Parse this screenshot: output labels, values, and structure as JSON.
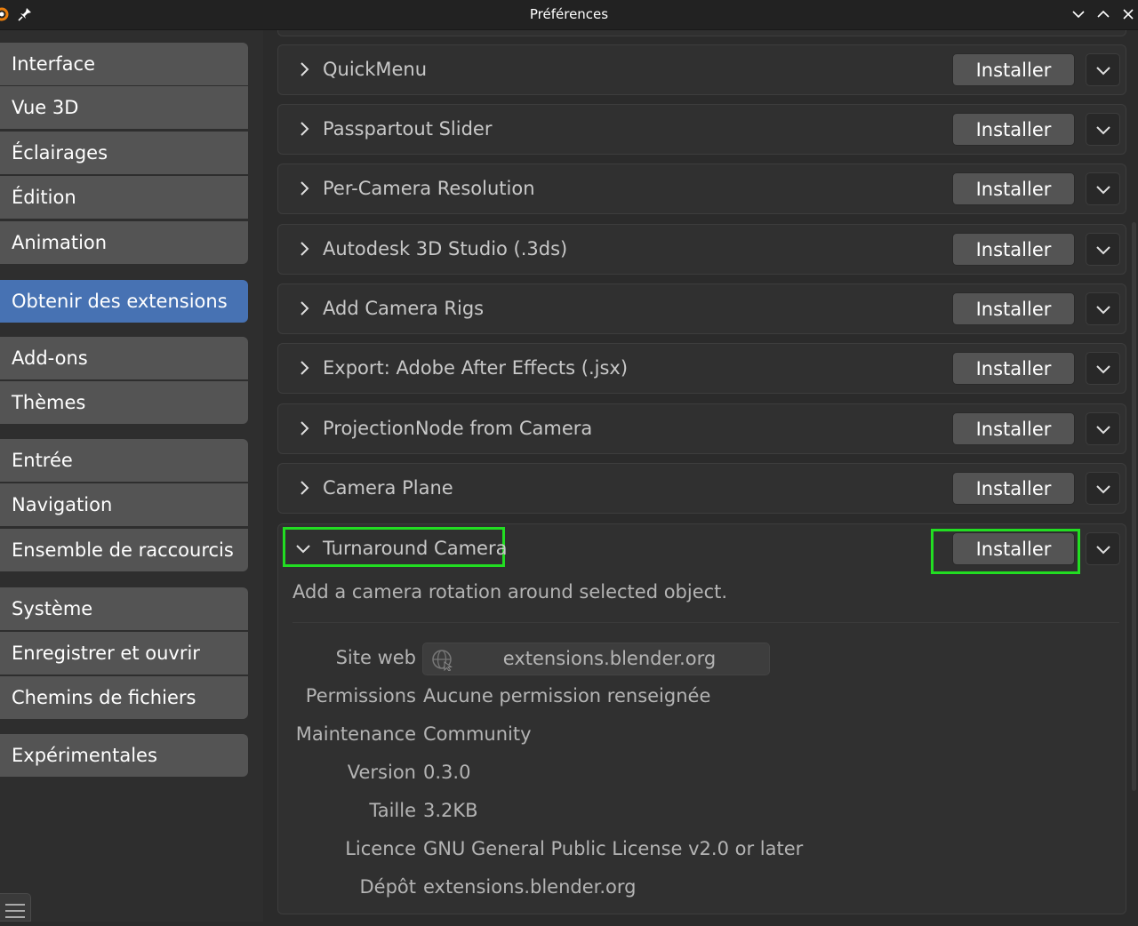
{
  "window": {
    "title": "Préférences"
  },
  "sidebar": {
    "items": [
      {
        "label": "Interface"
      },
      {
        "label": "Vue 3D"
      },
      {
        "label": "Éclairages"
      },
      {
        "label": "Édition"
      },
      {
        "label": "Animation"
      },
      {
        "label": "Obtenir des extensions",
        "active": true
      },
      {
        "label": "Add-ons"
      },
      {
        "label": "Thèmes"
      },
      {
        "label": "Entrée"
      },
      {
        "label": "Navigation"
      },
      {
        "label": "Ensemble de raccourcis"
      },
      {
        "label": "Système"
      },
      {
        "label": "Enregistrer et ouvrir"
      },
      {
        "label": "Chemins de fichiers"
      },
      {
        "label": "Expérimentales"
      }
    ]
  },
  "extensions": {
    "install_label": "Installer",
    "list": [
      {
        "name": "QuickMenu"
      },
      {
        "name": "Passpartout Slider"
      },
      {
        "name": "Per-Camera Resolution"
      },
      {
        "name": "Autodesk 3D Studio (.3ds)"
      },
      {
        "name": "Add Camera Rigs"
      },
      {
        "name": "Export: Adobe After Effects (.jsx)"
      },
      {
        "name": "ProjectionNode from Camera"
      },
      {
        "name": "Camera Plane"
      }
    ],
    "expanded": {
      "name": "Turnaround Camera",
      "description": "Add a camera rotation around selected object.",
      "details": {
        "website_label": "Site web",
        "website_value": "extensions.blender.org",
        "permissions_label": "Permissions",
        "permissions_value": "Aucune permission renseignée",
        "maintenance_label": "Maintenance",
        "maintenance_value": "Community",
        "version_label": "Version",
        "version_value": "0.3.0",
        "size_label": "Taille",
        "size_value": "3.2KB",
        "license_label": "Licence",
        "license_value": "GNU General Public License v2.0 or later",
        "repo_label": "Dépôt",
        "repo_value": "extensions.blender.org"
      }
    }
  },
  "colors": {
    "accent": "#4772b3",
    "highlight": "#22dd22",
    "button": "#545454",
    "panel": "#303030"
  }
}
